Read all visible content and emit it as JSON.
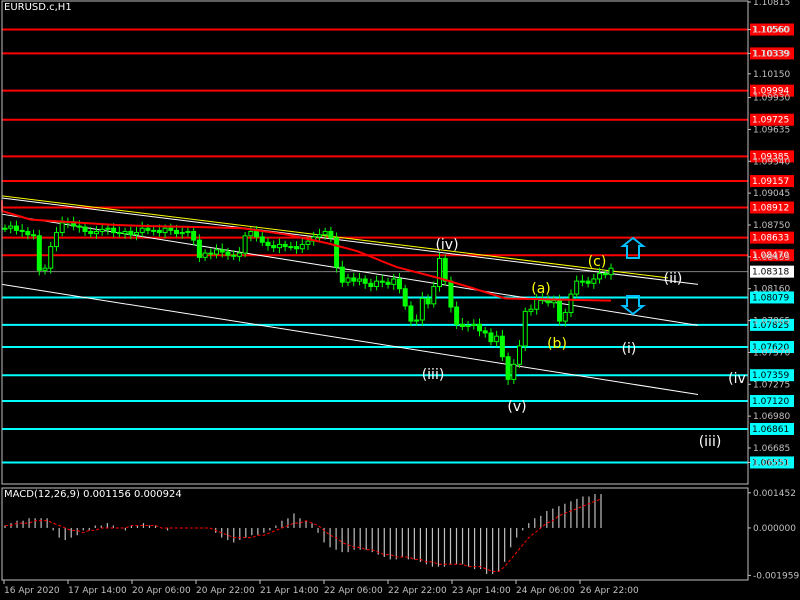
{
  "symbol_title": "EURUSD.c,H1",
  "macd_title": "MACD(12,26,9) 0.001156 0.000924",
  "colors": {
    "background": "#000000",
    "axis": "#c0c0c0",
    "candle": "#00ff00",
    "support": "#00ffff",
    "resistance": "#ff0000",
    "ma": "#ff0000",
    "channel": "#ffffff",
    "trendline": "#ffff00",
    "wave_white": "#ffffff",
    "wave_yellow": "#ffff00",
    "arrow": "#00bfff",
    "current_price_box": "#ffffff"
  },
  "chart_data": [
    {
      "type": "candlestick",
      "title": "EURUSD.c,H1",
      "ylim": [
        1.0637,
        1.10815
      ],
      "y_ticks": [
        "1.10815",
        "1.10560",
        "1.10339",
        "1.10150",
        "1.09930",
        "1.09635",
        "1.09340",
        "1.09045",
        "1.08750",
        "1.08455",
        "1.08160",
        "1.07865",
        "1.07570",
        "1.07275",
        "1.06980",
        "1.06685",
        "1.06551"
      ],
      "x_ticks": [
        "16 Apr 2020",
        "17 Apr 14:00",
        "20 Apr 06:00",
        "20 Apr 22:00",
        "21 Apr 14:00",
        "22 Apr 06:00",
        "22 Apr 22:00",
        "23 Apr 14:00",
        "24 Apr 06:00",
        "26 Apr 22:00"
      ],
      "price_path": [
        1.0872,
        1.0874,
        1.087,
        1.0869,
        1.0866,
        1.0865,
        1.0833,
        1.0835,
        1.0855,
        1.0868,
        1.0877,
        1.0878,
        1.0874,
        1.0873,
        1.0869,
        1.0867,
        1.0869,
        1.0871,
        1.0872,
        1.0868,
        1.0867,
        1.0869,
        1.0866,
        1.0868,
        1.0872,
        1.087,
        1.087,
        1.0868,
        1.0872,
        1.087,
        1.0867,
        1.0868,
        1.0869,
        1.0861,
        1.0845,
        1.0849,
        1.0848,
        1.0852,
        1.085,
        1.0847,
        1.0846,
        1.0849,
        1.0865,
        1.0869,
        1.0864,
        1.0859,
        1.0856,
        1.0854,
        1.0857,
        1.0855,
        1.0855,
        1.0853,
        1.0857,
        1.086,
        1.0864,
        1.0866,
        1.0869,
        1.0863,
        1.0836,
        1.0822,
        1.0826,
        1.0823,
        1.0825,
        1.0821,
        1.0818,
        1.0823,
        1.0822,
        1.082,
        1.0825,
        1.0816,
        1.08,
        1.0786,
        1.0787,
        1.0807,
        1.0802,
        1.0818,
        1.0844,
        1.0823,
        1.0799,
        1.0783,
        1.0781,
        1.0782,
        1.0783,
        1.0777,
        1.0775,
        1.0767,
        1.0772,
        1.0753,
        1.0732,
        1.0746,
        1.0763,
        1.0795,
        1.0797,
        1.0806,
        1.0806,
        1.0803,
        1.0805,
        1.0786,
        1.0794,
        1.0811,
        1.0823,
        1.0823,
        1.0821,
        1.0825,
        1.083,
        1.0829,
        1.0835
      ],
      "ma_path": [
        [
          1.0898,
          1.0885
        ],
        [
          1.0888,
          1.088
        ],
        [
          1.088,
          1.0875
        ],
        [
          1.0875,
          1.0874
        ],
        [
          1.0874,
          1.0873
        ],
        [
          1.0873,
          1.0872
        ],
        [
          1.0872,
          1.0866
        ],
        [
          1.0866,
          1.0858
        ],
        [
          1.0858,
          1.0851
        ],
        [
          1.0851,
          1.0836
        ],
        [
          1.0836,
          1.0825
        ],
        [
          1.0825,
          1.0817
        ],
        [
          1.0817,
          1.0807
        ],
        [
          1.0807,
          1.0805
        ]
      ],
      "ma_anchor": [
        2,
        6,
        15,
        30,
        36,
        45,
        52,
        60,
        67,
        72,
        79,
        87,
        92,
        98
      ],
      "support_levels": [
        "1.08079",
        "1.07825",
        "1.07620",
        "1.07359",
        "1.07120",
        "1.06861",
        "1.06551"
      ],
      "resistance_levels": [
        "1.10560",
        "1.10339",
        "1.09994",
        "1.09725",
        "1.09385",
        "1.09157",
        "1.08912",
        "1.08633",
        "1.08470"
      ],
      "current_price": "1.08318",
      "wave_labels_white": [
        "(iv)",
        "(ii)",
        "(iii)",
        "(i)",
        "(v)",
        "(iv",
        "(iii)"
      ],
      "wave_labels_yellow": [
        "(c)",
        "(a)",
        "(b)"
      ],
      "channels": [
        {
          "from": [
            "16 Apr 2020",
            1.09
          ],
          "to": [
            "26 Apr 22:00",
            1.082
          ]
        },
        {
          "from": [
            "16 Apr 2020",
            1.0885
          ],
          "to": [
            "26 Apr 22:00",
            1.0782
          ]
        },
        {
          "from": [
            "16 Apr 2020",
            1.082
          ],
          "to": [
            "26 Apr 22:00",
            1.0718
          ]
        }
      ],
      "trendline": {
        "from": [
          "16 Apr 2020",
          1.0902
        ],
        "to": [
          "26 Apr 22:00",
          1.0826
        ]
      }
    },
    {
      "type": "bar",
      "title": "MACD(12,26,9) 0.001156 0.000924",
      "ylim": [
        -0.00215,
        0.00165
      ],
      "y_ticks": [
        "0.001452",
        "0.000000",
        "-0.001959"
      ],
      "histogram": [
        0.0001,
        0.0002,
        0.0003,
        0.0003,
        0.0004,
        0.0004,
        0.0004,
        0.0004,
        -0.0001,
        -0.0004,
        -0.0005,
        -0.0004,
        -0.0003,
        -0.0001,
        -0.0001,
        0.0001,
        0.0001,
        0.0002,
        0.0001,
        0.0,
        -0.0001,
        0.0001,
        0.0001,
        0.0002,
        0.0001,
        0.0001,
        0.0,
        -0.0001,
        0.0,
        0.0,
        0.0,
        0.0,
        0.0,
        0.0,
        0.0,
        -0.0002,
        -0.0004,
        -0.0005,
        -0.0006,
        -0.0005,
        -0.0004,
        -0.0003,
        -0.0003,
        -0.0002,
        -0.0001,
        0.0001,
        0.0003,
        0.0004,
        0.0006,
        0.0004,
        0.0003,
        0.0002,
        -0.0002,
        -0.0006,
        -0.0008,
        -0.0009,
        -0.001,
        -0.001,
        -0.0009,
        -0.0009,
        -0.0009,
        -0.001,
        -0.0011,
        -0.0012,
        -0.0013,
        -0.0013,
        -0.0012,
        -0.0013,
        -0.0013,
        -0.0014,
        -0.0015,
        -0.0016,
        -0.0016,
        -0.0016,
        -0.0015,
        -0.0015,
        -0.0015,
        -0.0016,
        -0.0017,
        -0.0017,
        -0.0019,
        -0.0019,
        -0.0018,
        -0.0014,
        -0.0008,
        -0.0004,
        -0.0001,
        0.0002,
        0.0004,
        0.0005,
        0.0007,
        0.0008,
        0.0009,
        0.001,
        0.0011,
        0.0012,
        0.0013,
        0.0013,
        0.0014,
        0.0014
      ],
      "signal": [
        0.0001,
        0.0001,
        0.0002,
        0.0002,
        0.0002,
        0.0003,
        0.0003,
        0.0003,
        0.0002,
        0.0001,
        0.0,
        -0.0001,
        -0.0001,
        -0.0002,
        -0.0001,
        -0.0001,
        -0.0,
        0.0,
        0.0,
        0.0,
        0.0,
        0.0001,
        0.0001,
        0.0001,
        0.0001,
        0.0001,
        0.0,
        0.0,
        0.0,
        0.0,
        0.0,
        0.0,
        0.0,
        0.0,
        0.0,
        -0.0001,
        -0.0002,
        -0.0003,
        -0.0004,
        -0.0004,
        -0.0004,
        -0.0004,
        -0.0003,
        -0.0003,
        -0.0002,
        -0.0001,
        0.0,
        0.0001,
        0.0002,
        0.0002,
        0.0003,
        0.0002,
        0.0001,
        -0.0001,
        -0.0003,
        -0.0004,
        -0.0006,
        -0.0007,
        -0.0008,
        -0.0008,
        -0.0009,
        -0.0009,
        -0.001,
        -0.0011,
        -0.0011,
        -0.0012,
        -0.0012,
        -0.0012,
        -0.0013,
        -0.0013,
        -0.0014,
        -0.0014,
        -0.0015,
        -0.0015,
        -0.0015,
        -0.0015,
        -0.0015,
        -0.0016,
        -0.0016,
        -0.0016,
        -0.0017,
        -0.0018,
        -0.0018,
        -0.0016,
        -0.0013,
        -0.001,
        -0.0007,
        -0.0004,
        -0.0002,
        0.0,
        0.0002,
        0.0003,
        0.0005,
        0.0006,
        0.0007,
        0.0008,
        0.0009,
        0.001,
        0.0011,
        0.0012
      ]
    }
  ]
}
